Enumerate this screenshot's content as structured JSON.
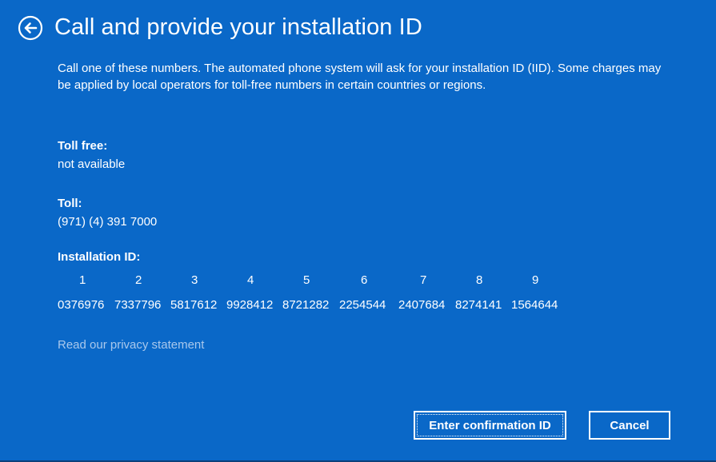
{
  "header": {
    "title": "Call and provide your installation ID",
    "back_icon": "back-arrow-circle-icon"
  },
  "description": "Call one of these numbers. The automated phone system will ask for your installation ID (IID). Some charges may be applied by local operators for toll-free numbers in certain countries or regions.",
  "toll_free": {
    "label": "Toll free:",
    "value": "not available"
  },
  "toll": {
    "label": "Toll:",
    "value": "(971) (4) 391 7000"
  },
  "installation_id": {
    "label": "Installation ID:",
    "indexes": [
      "1",
      "2",
      "3",
      "4",
      "5",
      "6",
      "7",
      "8",
      "9"
    ],
    "groups": [
      "0376976",
      "7337796",
      "5817612",
      "9928412",
      "8721282",
      "2254544",
      "2407684",
      "8274141",
      "1564644"
    ]
  },
  "privacy_link": "Read our privacy statement",
  "buttons": {
    "confirm": "Enter confirmation ID",
    "cancel": "Cancel"
  },
  "colors": {
    "background": "#0a68c8",
    "text": "#ffffff",
    "link": "#a9c8ec"
  }
}
